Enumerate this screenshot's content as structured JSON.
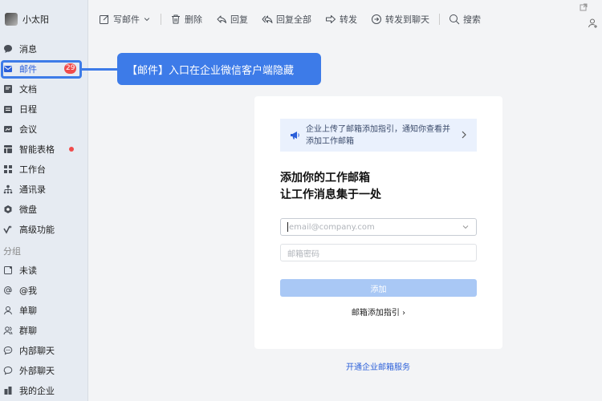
{
  "profile": {
    "name": "小太阳"
  },
  "sidebar": {
    "items": [
      {
        "label": "消息",
        "icon": "chat-bubble-icon"
      },
      {
        "label": "邮件",
        "icon": "mail-icon",
        "badge": "29",
        "active": true
      },
      {
        "label": "文档",
        "icon": "document-icon"
      },
      {
        "label": "日程",
        "icon": "calendar-icon"
      },
      {
        "label": "会议",
        "icon": "meeting-icon"
      },
      {
        "label": "智能表格",
        "icon": "smart-table-icon",
        "dot": true
      },
      {
        "label": "工作台",
        "icon": "workbench-grid-icon"
      },
      {
        "label": "通讯录",
        "icon": "contacts-icon"
      },
      {
        "label": "微盘",
        "icon": "drive-icon"
      },
      {
        "label": "高级功能",
        "icon": "advanced-icon"
      }
    ],
    "group_label": "分组",
    "groups": [
      {
        "label": "未读",
        "icon": "unread-icon"
      },
      {
        "label": "@我",
        "icon": "at-icon"
      },
      {
        "label": "单聊",
        "icon": "single-chat-icon"
      },
      {
        "label": "群聊",
        "icon": "group-chat-icon"
      },
      {
        "label": "内部聊天",
        "icon": "internal-chat-icon"
      },
      {
        "label": "外部聊天",
        "icon": "external-chat-icon"
      },
      {
        "label": "我的企业",
        "icon": "enterprise-icon"
      }
    ]
  },
  "toolbar": {
    "compose": "写邮件",
    "delete": "删除",
    "reply": "回复",
    "reply_all": "回复全部",
    "forward": "转发",
    "forward_chat": "转发到聊天",
    "search": "搜索"
  },
  "callout": {
    "text": "【邮件】入口在企业微信客户端隐藏"
  },
  "card": {
    "notice": "企业上传了邮箱添加指引，通知你查看并添加工作邮箱",
    "title_line1": "添加你的工作邮箱",
    "title_line2": "让工作消息集于一处",
    "email_placeholder": "email@company.com",
    "password_placeholder": "邮箱密码",
    "submit_label": "添加",
    "guide_link": "邮箱添加指引 ›"
  },
  "footer": {
    "open_service_link": "开通企业邮箱服务"
  },
  "colors": {
    "accent": "#3d7be8",
    "badge": "#f04b4b",
    "submit_disabled": "#a9c8f5"
  }
}
